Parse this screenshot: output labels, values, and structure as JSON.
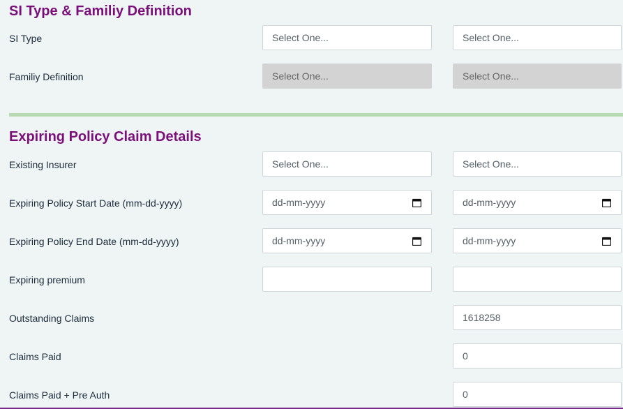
{
  "si_section": {
    "title": "SI Type & Familiy Definition",
    "rows": [
      {
        "label": "SI Type",
        "col1": "Select One...",
        "col2": "Select One..."
      },
      {
        "label": "Familiy Definition",
        "col1": "Select One...",
        "col2": "Select One..."
      }
    ]
  },
  "claim_section": {
    "title": "Expiring Policy Claim Details",
    "existing_insurer": {
      "label": "Existing Insurer",
      "col1": "Select One...",
      "col2": "Select One..."
    },
    "start_date": {
      "label": "Expiring Policy Start Date (mm-dd-yyyy)",
      "col1": "dd-mm-yyyy",
      "col2": "dd-mm-yyyy"
    },
    "end_date": {
      "label": "Expiring Policy End Date (mm-dd-yyyy)",
      "col1": "dd-mm-yyyy",
      "col2": "dd-mm-yyyy"
    },
    "premium": {
      "label": "Expiring premium",
      "col1": "",
      "col2": ""
    },
    "outstanding": {
      "label": "Outstanding Claims",
      "col2": "1618258"
    },
    "claims_paid": {
      "label": "Claims Paid",
      "col2": "0"
    },
    "claims_paid_preauth": {
      "label": "Claims Paid + Pre Auth",
      "col2": "0"
    }
  },
  "icons": {
    "date_picker": "calendar-icon"
  },
  "colors": {
    "heading": "#7a0f7a",
    "divider": "#b7d9b4",
    "background": "#eff5f5",
    "disabled_field": "#d3d3d3"
  }
}
